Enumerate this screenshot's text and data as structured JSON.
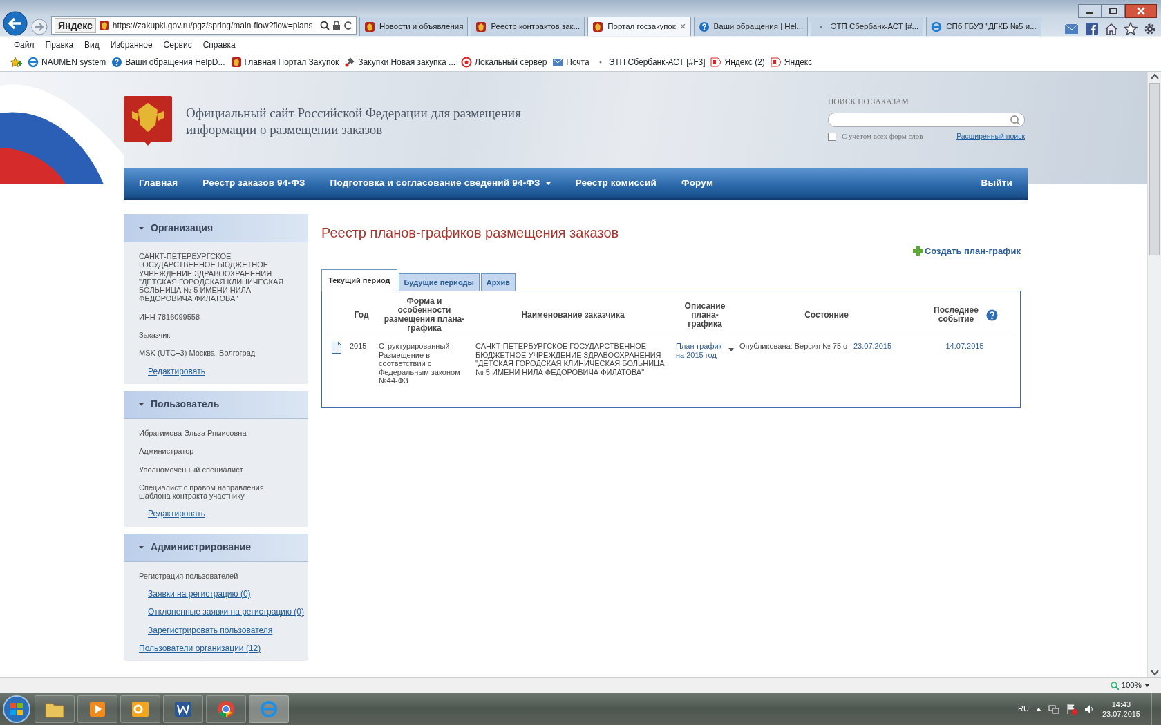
{
  "browser": {
    "address": {
      "search_brand": "Яндекс",
      "url": "https://zakupki.gov.ru/pgz/spring/main-flow?flow=plans_"
    },
    "tabs": [
      {
        "label": "Новости и объявления",
        "selected": false
      },
      {
        "label": "Реестр контрактов зак...",
        "selected": false
      },
      {
        "label": "Портал госзакупок",
        "selected": true,
        "close": "×"
      },
      {
        "label": "Ваши обращения | Hel...",
        "selected": false
      },
      {
        "label": "ЭТП Сбербанк-АСТ [#...",
        "selected": false
      },
      {
        "label": "СПб ГБУЗ \"ДГКБ №5 и...",
        "selected": false
      }
    ],
    "menu": [
      "Файл",
      "Правка",
      "Вид",
      "Избранное",
      "Сервис",
      "Справка"
    ],
    "favorites": [
      "NAUMEN system",
      "Ваши обращения  HelpD...",
      "Главная Портал Закупок",
      "Закупки  Новая закупка  ...",
      "Локальный сервер",
      "Почта",
      "ЭТП Сбербанк-АСТ [#F3]",
      "Яндекс (2)",
      "Яндекс"
    ]
  },
  "site": {
    "title": "Официальный сайт Российской Федерации для размещения информации о размещении заказов",
    "search": {
      "label": "ПОИСК ПО ЗАКАЗАМ",
      "all_forms": {
        "label": "С учетом всех форм слов",
        "checked": false
      },
      "advanced_link": "Расширенный поиск"
    },
    "nav": [
      {
        "label": "Главная",
        "dropdown": false
      },
      {
        "label": "Реестр заказов 94-ФЗ",
        "dropdown": false
      },
      {
        "label": "Подготовка и согласование сведений 94-ФЗ",
        "dropdown": true
      },
      {
        "label": "Реестр комиссий",
        "dropdown": false
      },
      {
        "label": "Форум",
        "dropdown": false
      }
    ],
    "logout": "Выйти"
  },
  "sidebar": [
    {
      "title": "Организация",
      "expanded": true,
      "items": [
        {
          "kind": "text",
          "text": "САНКТ-ПЕТЕРБУРГСКОЕ ГОСУДАРСТВЕННОЕ БЮДЖЕТНОЕ УЧРЕЖДЕНИЕ ЗДРАВООХРАНЕНИЯ \"ДЕТСКАЯ ГОРОДСКАЯ КЛИНИЧЕСКАЯ БОЛЬНИЦА № 5 ИМЕНИ НИЛА ФЕДОРОВИЧА ФИЛАТОВА\""
        },
        {
          "kind": "text",
          "text": "ИНН 7816099558"
        },
        {
          "kind": "text",
          "text": "Заказчик"
        },
        {
          "kind": "text",
          "text": "MSK (UTC+3) Москва, Волгоград"
        },
        {
          "kind": "sublink",
          "text": "Редактировать"
        }
      ]
    },
    {
      "title": "Пользователь",
      "expanded": true,
      "items": [
        {
          "kind": "text",
          "text": "Ибрагимова Эльза Рямисовна"
        },
        {
          "kind": "text",
          "text": "Администратор"
        },
        {
          "kind": "text",
          "text": "Уполномоченный специалист"
        },
        {
          "kind": "text",
          "text": "Специалист с правом направления шаблона контракта участнику"
        },
        {
          "kind": "sublink",
          "text": "Редактировать"
        }
      ]
    },
    {
      "title": "Администрирование",
      "expanded": true,
      "items": [
        {
          "kind": "text",
          "text": "Регистрация пользователей"
        },
        {
          "kind": "sublink",
          "text": "Заявки на регистрацию (0)"
        },
        {
          "kind": "sublink",
          "text": "Отклоненные заявки на регистрацию (0)"
        },
        {
          "kind": "sublink",
          "text": "Зарегистрировать пользователя"
        },
        {
          "kind": "link",
          "text": "Пользователи организации (12)"
        }
      ]
    }
  ],
  "main": {
    "heading": "Реестр планов-графиков размещения заказов",
    "create_link": "Создать план-график",
    "tabs": [
      {
        "label": "Текущий период",
        "selected": true
      },
      {
        "label": "Будущие периоды",
        "selected": false
      },
      {
        "label": "Архив",
        "selected": false
      }
    ],
    "table": {
      "columns": [
        "Год",
        "Форма и особенности размещения плана-графика",
        "Наименование заказчика",
        "Описание плана-графика",
        "Состояние",
        "Последнее событие"
      ],
      "rows": [
        {
          "year": "2015",
          "form": "Структурированный Размещение в соответствии с Федеральным законом №44-ФЗ",
          "customer": "САНКТ-ПЕТЕРБУРГСКОЕ ГОСУДАРСТВЕННОЕ БЮДЖЕТНОЕ УЧРЕЖДЕНИЕ ЗДРАВООХРАНЕНИЯ \"ДЕТСКАЯ ГОРОДСКАЯ КЛИНИЧЕСКАЯ БОЛЬНИЦА № 5 ИМЕНИ НИЛА ФЕДОРОВИЧА ФИЛАТОВА\"",
          "description": "План-график на 2015 год",
          "status": "Опубликована: Версия №  75 от",
          "status_date": "23.07.2015",
          "last_event": "14.07.2015"
        }
      ]
    }
  },
  "status_bar": {
    "zoom": "100%"
  },
  "taskbar": {
    "language": "RU",
    "time": "14:43",
    "date": "23.07.2015"
  }
}
